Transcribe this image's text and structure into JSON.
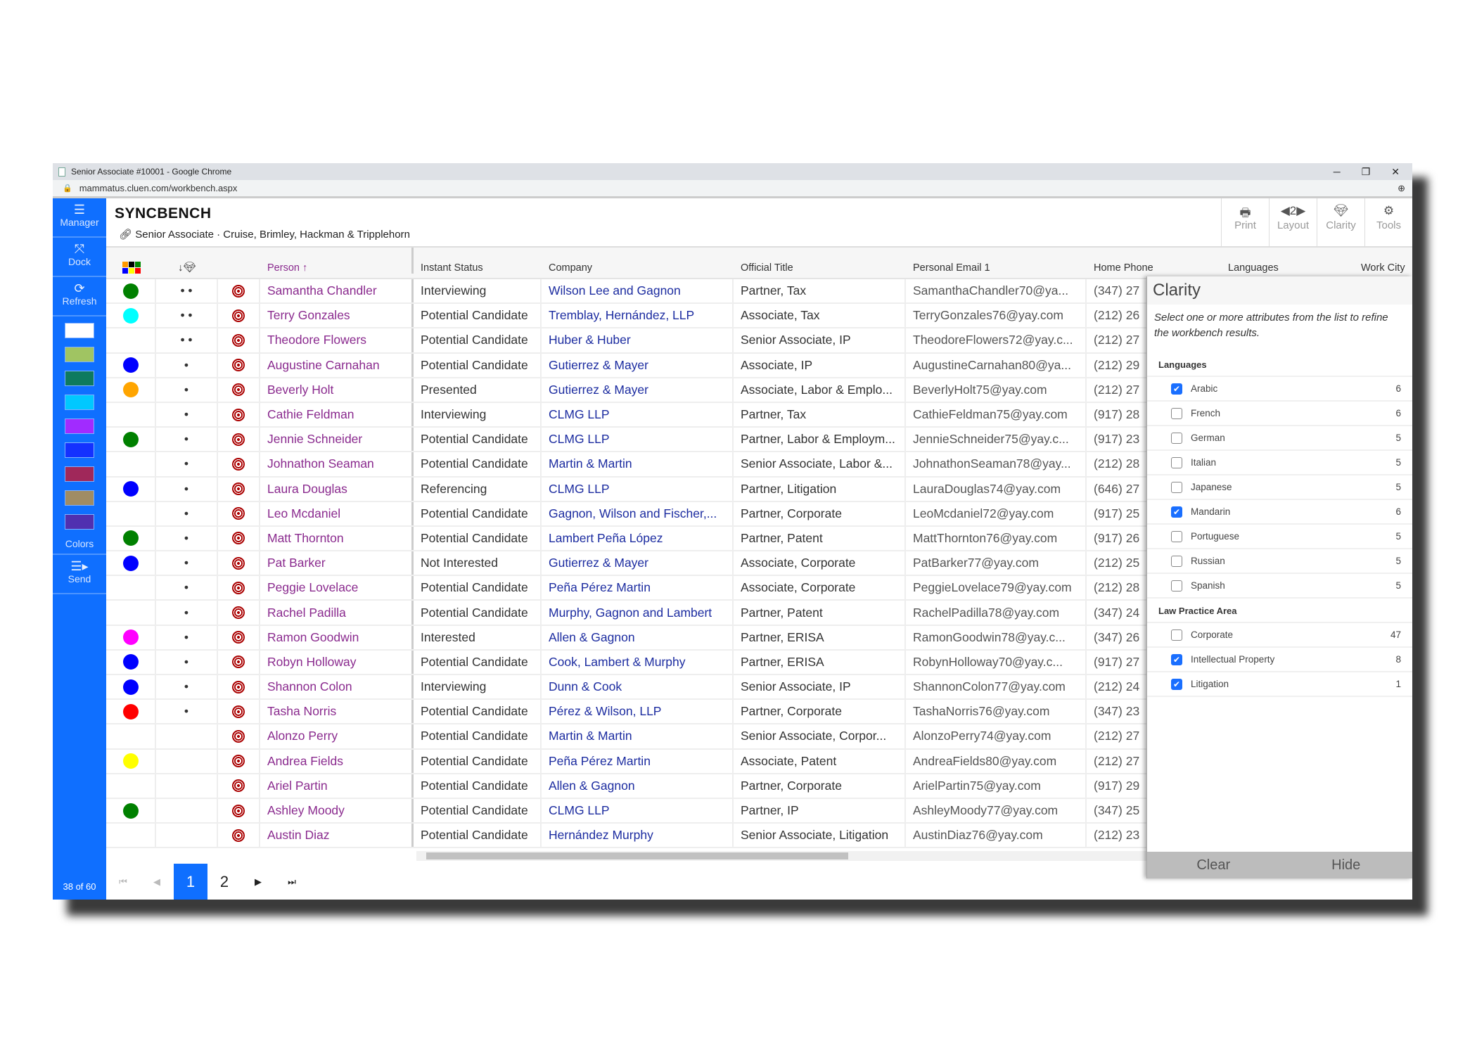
{
  "browser": {
    "title": "Senior Associate #10001 - Google Chrome",
    "url": "mammatus.cluen.com/workbench.aspx",
    "controls": [
      "─",
      "❐",
      "✕"
    ]
  },
  "sidebar": {
    "manager": "Manager",
    "dock": "Dock",
    "refresh": "Refresh",
    "colors_label": "Colors",
    "send": "Send",
    "count": "38 of 60",
    "swatches": [
      "#ffffff",
      "#a0c462",
      "#0e7a5e",
      "#00c8ff",
      "#a12bff",
      "#1431ff",
      "#a0285a",
      "#a08c64",
      "#5030b0"
    ]
  },
  "header": {
    "title": "SYNCBENCH",
    "subtitle": "Senior Associate · Cruise, Brimley, Hackman & Tripplehorn"
  },
  "toolbar": {
    "print": "Print",
    "layout": "Layout",
    "layout_num": "◀2▶",
    "clarity": "Clarity",
    "tools": "Tools"
  },
  "columns": {
    "person": "Person ↑",
    "status": "Instant Status",
    "company": "Company",
    "title": "Official Title",
    "email": "Personal Email 1",
    "phone": "Home Phone",
    "languages": "Languages",
    "city": "Work City"
  },
  "rows": [
    {
      "color": "#008000",
      "dots": "• •",
      "name": "Samantha Chandler",
      "status": "Interviewing",
      "company": "Wilson Lee and Gagnon",
      "title": "Partner, Tax",
      "email": "SamanthaChandler70@ya...",
      "phone": "(347) 27"
    },
    {
      "color": "#00ffff",
      "dots": "• •",
      "name": "Terry Gonzales",
      "status": "Potential Candidate",
      "company": "Tremblay, Hernández, LLP",
      "title": "Associate, Tax",
      "email": "TerryGonzales76@yay.com",
      "phone": "(212) 26"
    },
    {
      "color": "",
      "dots": "• •",
      "name": "Theodore Flowers",
      "status": "Potential Candidate",
      "company": "Huber & Huber",
      "title": "Senior Associate, IP",
      "email": "TheodoreFlowers72@yay.c...",
      "phone": "(212) 27"
    },
    {
      "color": "#0000ff",
      "dots": "•",
      "name": "Augustine Carnahan",
      "status": "Potential Candidate",
      "company": "Gutierrez & Mayer",
      "title": "Associate, IP",
      "email": "AugustineCarnahan80@ya...",
      "phone": "(212) 29"
    },
    {
      "color": "#ffa500",
      "dots": "•",
      "name": "Beverly Holt",
      "status": "Presented",
      "company": "Gutierrez & Mayer",
      "title": "Associate, Labor & Emplo...",
      "email": "BeverlyHolt75@yay.com",
      "phone": "(212) 27"
    },
    {
      "color": "",
      "dots": "•",
      "name": "Cathie Feldman",
      "status": "Interviewing",
      "company": "CLMG LLP",
      "title": "Partner, Tax",
      "email": "CathieFeldman75@yay.com",
      "phone": "(917) 28"
    },
    {
      "color": "#008000",
      "dots": "•",
      "name": "Jennie Schneider",
      "status": "Potential Candidate",
      "company": "CLMG LLP",
      "title": "Partner, Labor & Employm...",
      "email": "JennieSchneider75@yay.c...",
      "phone": "(917) 23"
    },
    {
      "color": "",
      "dots": "•",
      "name": "Johnathon Seaman",
      "status": "Potential Candidate",
      "company": "Martin & Martin",
      "title": "Senior Associate, Labor &...",
      "email": "JohnathonSeaman78@yay...",
      "phone": "(212) 28"
    },
    {
      "color": "#0000ff",
      "dots": "•",
      "name": "Laura Douglas",
      "status": "Referencing",
      "company": "CLMG LLP",
      "title": "Partner, Litigation",
      "email": "LauraDouglas74@yay.com",
      "phone": "(646) 27"
    },
    {
      "color": "",
      "dots": "•",
      "name": "Leo Mcdaniel",
      "status": "Potential Candidate",
      "company": "Gagnon, Wilson and Fischer,...",
      "title": "Partner, Corporate",
      "email": "LeoMcdaniel72@yay.com",
      "phone": "(917) 25"
    },
    {
      "color": "#008000",
      "dots": "•",
      "name": "Matt Thornton",
      "status": "Potential Candidate",
      "company": "Lambert Peña López",
      "title": "Partner, Patent",
      "email": "MattThornton76@yay.com",
      "phone": "(917) 26"
    },
    {
      "color": "#0000ff",
      "dots": "•",
      "name": "Pat Barker",
      "status": "Not Interested",
      "company": "Gutierrez & Mayer",
      "title": "Associate, Corporate",
      "email": "PatBarker77@yay.com",
      "phone": "(212) 25"
    },
    {
      "color": "",
      "dots": "•",
      "name": "Peggie Lovelace",
      "status": "Potential Candidate",
      "company": "Peña Pérez Martin",
      "title": "Associate, Corporate",
      "email": "PeggieLovelace79@yay.com",
      "phone": "(212) 28"
    },
    {
      "color": "",
      "dots": "•",
      "name": "Rachel Padilla",
      "status": "Potential Candidate",
      "company": "Murphy, Gagnon and Lambert",
      "title": "Partner, Patent",
      "email": "RachelPadilla78@yay.com",
      "phone": "(347) 24"
    },
    {
      "color": "#ff00ff",
      "dots": "•",
      "name": "Ramon Goodwin",
      "status": "Interested",
      "company": "Allen & Gagnon",
      "title": "Partner, ERISA",
      "email": "RamonGoodwin78@yay.c...",
      "phone": "(347) 26"
    },
    {
      "color": "#0000ff",
      "dots": "•",
      "name": "Robyn Holloway",
      "status": "Potential Candidate",
      "company": "Cook, Lambert & Murphy",
      "title": "Partner, ERISA",
      "email": "RobynHolloway70@yay.c...",
      "phone": "(917) 27"
    },
    {
      "color": "#0000ff",
      "dots": "•",
      "name": "Shannon Colon",
      "status": "Interviewing",
      "company": "Dunn & Cook",
      "title": "Senior Associate, IP",
      "email": "ShannonColon77@yay.com",
      "phone": "(212) 24"
    },
    {
      "color": "#ff0000",
      "dots": "•",
      "name": "Tasha Norris",
      "status": "Potential Candidate",
      "company": "Pérez & Wilson, LLP",
      "title": "Partner, Corporate",
      "email": "TashaNorris76@yay.com",
      "phone": "(347) 23"
    },
    {
      "color": "",
      "dots": "",
      "name": "Alonzo Perry",
      "status": "Potential Candidate",
      "company": "Martin & Martin",
      "title": "Senior Associate, Corpor...",
      "email": "AlonzoPerry74@yay.com",
      "phone": "(212) 27"
    },
    {
      "color": "#ffff00",
      "dots": "",
      "name": "Andrea Fields",
      "status": "Potential Candidate",
      "company": "Peña Pérez Martin",
      "title": "Associate, Patent",
      "email": "AndreaFields80@yay.com",
      "phone": "(212) 27"
    },
    {
      "color": "",
      "dots": "",
      "name": "Ariel Partin",
      "status": "Potential Candidate",
      "company": "Allen & Gagnon",
      "title": "Partner, Corporate",
      "email": "ArielPartin75@yay.com",
      "phone": "(917) 29"
    },
    {
      "color": "#008000",
      "dots": "",
      "name": "Ashley Moody",
      "status": "Potential Candidate",
      "company": "CLMG LLP",
      "title": "Partner, IP",
      "email": "AshleyMoody77@yay.com",
      "phone": "(347) 25"
    },
    {
      "color": "",
      "dots": "",
      "name": "Austin Diaz",
      "status": "Potential Candidate",
      "company": "Hernández Murphy",
      "title": "Senior Associate, Litigation",
      "email": "AustinDiaz76@yay.com",
      "phone": "(212) 23"
    }
  ],
  "pager": {
    "pages": [
      "1",
      "2"
    ],
    "current": "1"
  },
  "clarity": {
    "title": "Clarity",
    "description": "Select one or more attributes from the list to refine the workbench results.",
    "sections": [
      {
        "label": "Languages",
        "items": [
          {
            "label": "Arabic",
            "count": "6",
            "checked": true
          },
          {
            "label": "French",
            "count": "6",
            "checked": false
          },
          {
            "label": "German",
            "count": "5",
            "checked": false
          },
          {
            "label": "Italian",
            "count": "5",
            "checked": false
          },
          {
            "label": "Japanese",
            "count": "5",
            "checked": false
          },
          {
            "label": "Mandarin",
            "count": "6",
            "checked": true
          },
          {
            "label": "Portuguese",
            "count": "5",
            "checked": false
          },
          {
            "label": "Russian",
            "count": "5",
            "checked": false
          },
          {
            "label": "Spanish",
            "count": "5",
            "checked": false
          }
        ]
      },
      {
        "label": "Law Practice Area",
        "items": [
          {
            "label": "Corporate",
            "count": "47",
            "checked": false
          },
          {
            "label": "Intellectual Property",
            "count": "8",
            "checked": true
          },
          {
            "label": "Litigation",
            "count": "1",
            "checked": true
          }
        ]
      }
    ],
    "clear": "Clear",
    "hide": "Hide"
  }
}
